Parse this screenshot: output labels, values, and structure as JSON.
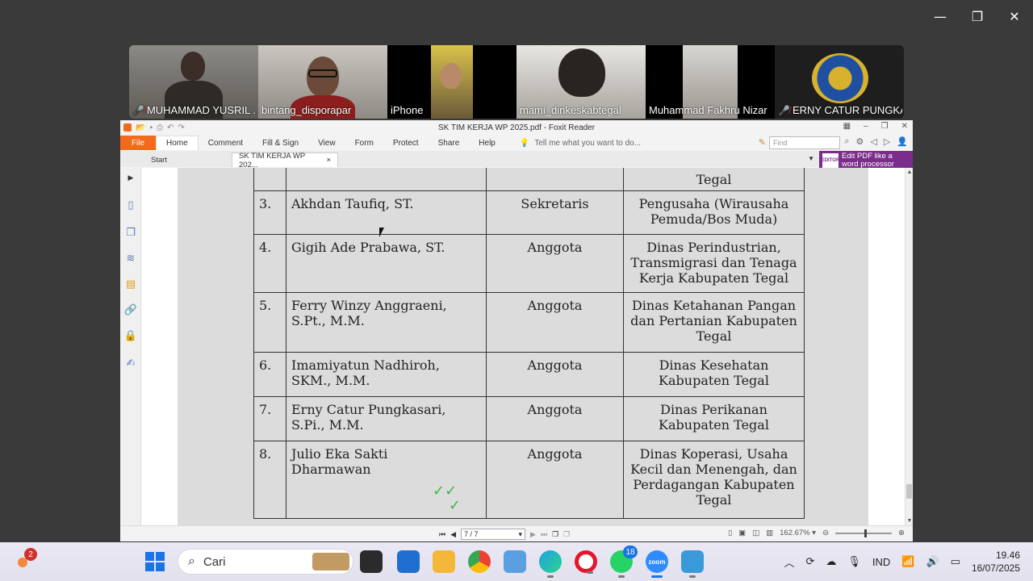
{
  "window_controls": {
    "minimize": "—",
    "restore": "❐",
    "close": "✕"
  },
  "participants": [
    {
      "name": "MUHAMMAD YUSRIL ...",
      "muted": true,
      "active": false
    },
    {
      "name": "bintang_disporapar",
      "muted": false,
      "active": true
    },
    {
      "name": "iPhone",
      "muted": false,
      "active": false
    },
    {
      "name": "mami_dinkeskabtegal",
      "muted": false,
      "active": false
    },
    {
      "name": "Muhammad Fakhru Nizar",
      "muted": false,
      "active": false
    },
    {
      "name": "ERNY CATUR PUNGKA...",
      "muted": true,
      "active": false
    }
  ],
  "foxit": {
    "title": "SK TIM KERJA WP 2025.pdf - Foxit Reader",
    "ribbon": {
      "file": "File",
      "tabs": [
        "Home",
        "Comment",
        "Fill & Sign",
        "View",
        "Form",
        "Protect",
        "Share",
        "Help"
      ],
      "tell_me": "Tell me what you want to do...",
      "find_placeholder": "Find"
    },
    "doc_tabs": {
      "start": "Start",
      "current": "SK TIM KERJA WP 202...",
      "close": "×"
    },
    "promo": {
      "line1": "Edit PDF like a",
      "line2": "word processor",
      "badge": "EDITOR"
    },
    "status": {
      "page": "7 / 7",
      "zoom": "162.67%"
    }
  },
  "document": {
    "top_fragment": "Tegal",
    "rows": [
      {
        "no": "3.",
        "name": [
          "Akhdan Taufiq, ST."
        ],
        "role": "Sekretaris",
        "inst": [
          "Pengusaha (Wirausaha",
          "Pemuda/Bos Muda)"
        ]
      },
      {
        "no": "4.",
        "name": [
          "Gigih Ade Prabawa, ST."
        ],
        "role": "Anggota",
        "inst": [
          "Dinas Perindustrian,",
          "Transmigrasi dan Tenaga",
          "Kerja Kabupaten Tegal"
        ]
      },
      {
        "no": "5.",
        "name": [
          "Ferry Winzy Anggraeni,",
          "S.Pt., M.M."
        ],
        "role": "Anggota",
        "inst": [
          "Dinas Ketahanan Pangan",
          "dan Pertanian Kabupaten",
          "Tegal"
        ]
      },
      {
        "no": "6.",
        "name": [
          "Imamiyatun Nadhiroh,",
          "SKM., M.M."
        ],
        "role": "Anggota",
        "inst": [
          "Dinas Kesehatan",
          "Kabupaten Tegal"
        ]
      },
      {
        "no": "7.",
        "name": [
          "Erny Catur Pungkasari,",
          "S.Pi., M.M."
        ],
        "role": "Anggota",
        "inst": [
          "Dinas Perikanan",
          "Kabupaten Tegal"
        ]
      },
      {
        "no": "8.",
        "name": [
          "Julio Eka Sakti",
          "Dharmawan"
        ],
        "role": "Anggota",
        "inst": [
          "Dinas Koperasi, Usaha",
          "Kecil dan Menengah, dan",
          "Perdagangan Kabupaten",
          "Tegal"
        ]
      }
    ]
  },
  "taskbar": {
    "notification_count": "2",
    "search_placeholder": "Cari",
    "whatsapp_badge": "18",
    "zoom_label": "zoom",
    "language": "IND",
    "time": "19.46",
    "date": "16/07/2025"
  },
  "colors": {
    "foxit_orange": "#f26b1d",
    "active_speaker": "#2cc46a",
    "promo_purple": "#7b2d8b",
    "check_green": "#3cb84a"
  }
}
